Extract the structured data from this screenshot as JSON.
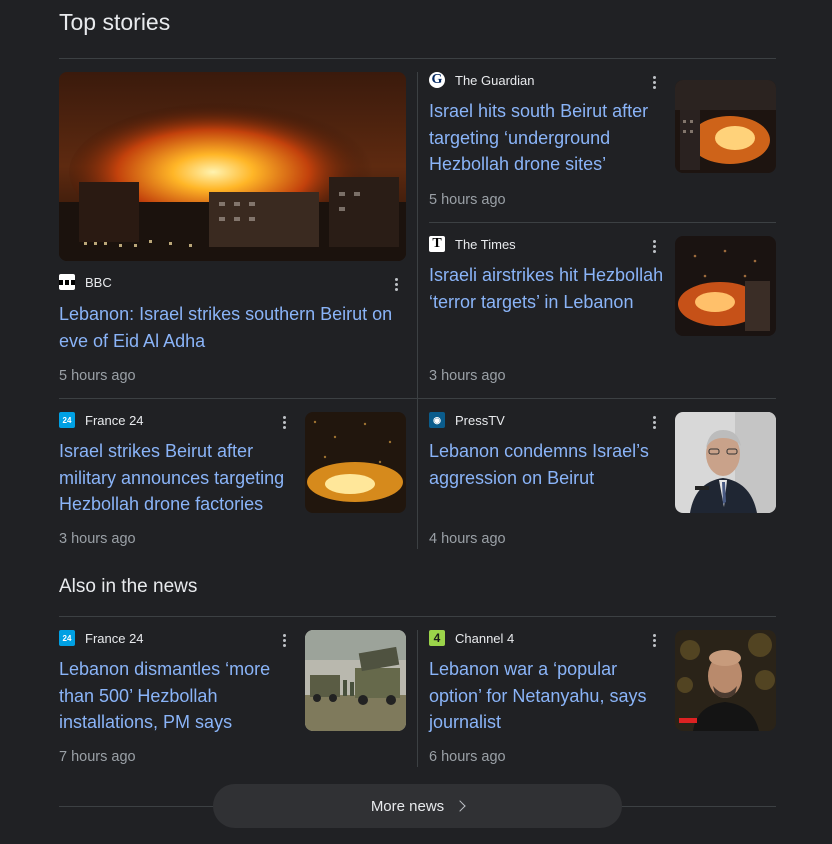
{
  "top_stories": {
    "title": "Top stories",
    "featured": {
      "source": "BBC",
      "headline": "Lebanon: Israel strikes southern Beirut on eve of Eid Al Adha",
      "time": "5 hours ago"
    },
    "guardian": {
      "source": "The Guardian",
      "headline": "Israel hits south Beirut after targeting ‘underground Hezbollah drone sites’",
      "time": "5 hours ago"
    },
    "times": {
      "source": "The Times",
      "headline": "Israeli airstrikes hit Hezbollah ‘terror targets’ in Lebanon",
      "time": "3 hours ago"
    },
    "france24": {
      "source": "France 24",
      "headline": "Israel strikes Beirut after military announces targeting Hezbollah drone factories",
      "time": "3 hours ago"
    },
    "presstv": {
      "source": "PressTV",
      "headline": "Lebanon condemns Israel’s aggression on Beirut",
      "time": "4 hours ago"
    }
  },
  "also_in_news": {
    "title": "Also in the news",
    "france24": {
      "source": "France 24",
      "headline": "Lebanon dismantles ‘more than 500’ Hezbollah installations, PM says",
      "time": "7 hours ago"
    },
    "channel4": {
      "source": "Channel 4",
      "headline": "Lebanon war a ‘popular option’ for Netanyahu, says journalist",
      "time": "6 hours ago"
    }
  },
  "more_news": {
    "label": "More news"
  },
  "icons": {
    "bbc": "bbc-logo-icon",
    "guardian": "guardian-logo-icon",
    "times": "times-logo-icon",
    "france24": "france24-logo-icon",
    "presstv": "presstv-logo-icon",
    "channel4": "channel4-logo-icon",
    "more": "more-vert-icon",
    "chevron": "chevron-right-icon"
  },
  "colors": {
    "background": "#202124",
    "link": "#8ab4f8",
    "muted": "#9aa0a6",
    "divider": "#3c4043"
  }
}
